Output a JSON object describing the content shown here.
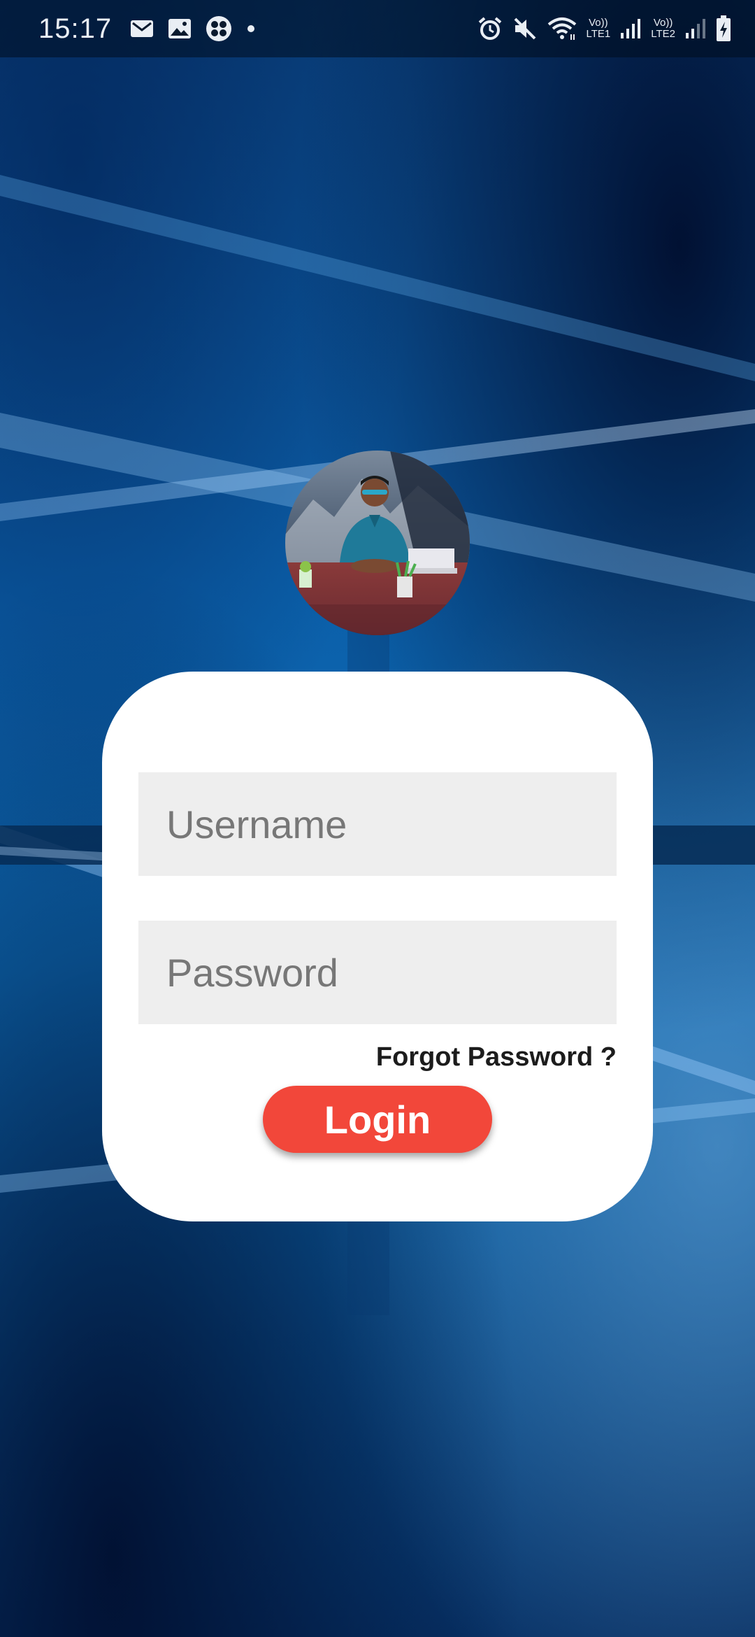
{
  "status_bar": {
    "time": "15:17",
    "left_icons": [
      "gmail-icon",
      "gallery-icon",
      "app-grid-icon",
      "notification-dot-icon"
    ],
    "right_icons": [
      "alarm-icon",
      "mute-icon",
      "wifi-icon",
      "signal-lte1-icon",
      "signal-lte2-icon",
      "battery-charging-icon"
    ],
    "sim1": {
      "top": "Vo))",
      "bottom": "LTE1"
    },
    "sim2": {
      "top": "Vo))",
      "bottom": "LTE2"
    }
  },
  "login": {
    "username_placeholder": "Username",
    "username_value": "",
    "password_placeholder": "Password",
    "password_value": "",
    "forgot_label": "Forgot Password ?",
    "login_label": "Login"
  },
  "colors": {
    "login_button": "#f2473a",
    "card": "#ffffff",
    "field_bg": "#eeeeee"
  }
}
